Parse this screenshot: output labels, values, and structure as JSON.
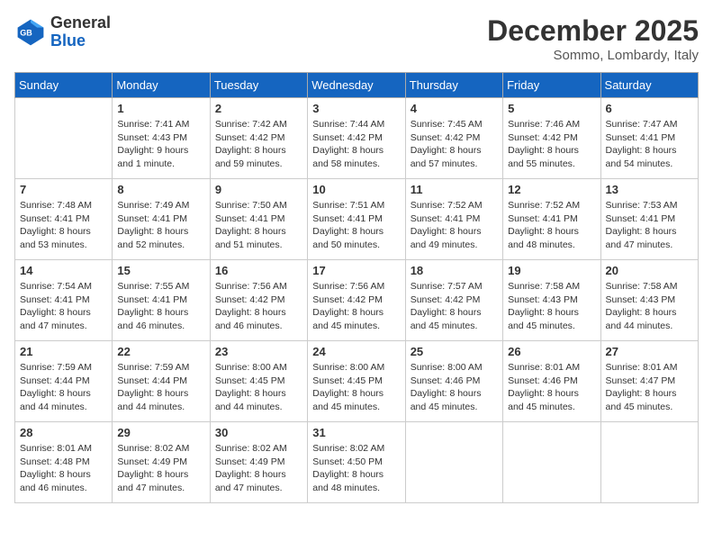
{
  "header": {
    "logo_general": "General",
    "logo_blue": "Blue",
    "month": "December 2025",
    "location": "Sommo, Lombardy, Italy"
  },
  "days_of_week": [
    "Sunday",
    "Monday",
    "Tuesday",
    "Wednesday",
    "Thursday",
    "Friday",
    "Saturday"
  ],
  "weeks": [
    [
      {
        "day": "",
        "content": ""
      },
      {
        "day": "1",
        "content": "Sunrise: 7:41 AM\nSunset: 4:43 PM\nDaylight: 9 hours\nand 1 minute."
      },
      {
        "day": "2",
        "content": "Sunrise: 7:42 AM\nSunset: 4:42 PM\nDaylight: 8 hours\nand 59 minutes."
      },
      {
        "day": "3",
        "content": "Sunrise: 7:44 AM\nSunset: 4:42 PM\nDaylight: 8 hours\nand 58 minutes."
      },
      {
        "day": "4",
        "content": "Sunrise: 7:45 AM\nSunset: 4:42 PM\nDaylight: 8 hours\nand 57 minutes."
      },
      {
        "day": "5",
        "content": "Sunrise: 7:46 AM\nSunset: 4:42 PM\nDaylight: 8 hours\nand 55 minutes."
      },
      {
        "day": "6",
        "content": "Sunrise: 7:47 AM\nSunset: 4:41 PM\nDaylight: 8 hours\nand 54 minutes."
      }
    ],
    [
      {
        "day": "7",
        "content": "Sunrise: 7:48 AM\nSunset: 4:41 PM\nDaylight: 8 hours\nand 53 minutes."
      },
      {
        "day": "8",
        "content": "Sunrise: 7:49 AM\nSunset: 4:41 PM\nDaylight: 8 hours\nand 52 minutes."
      },
      {
        "day": "9",
        "content": "Sunrise: 7:50 AM\nSunset: 4:41 PM\nDaylight: 8 hours\nand 51 minutes."
      },
      {
        "day": "10",
        "content": "Sunrise: 7:51 AM\nSunset: 4:41 PM\nDaylight: 8 hours\nand 50 minutes."
      },
      {
        "day": "11",
        "content": "Sunrise: 7:52 AM\nSunset: 4:41 PM\nDaylight: 8 hours\nand 49 minutes."
      },
      {
        "day": "12",
        "content": "Sunrise: 7:52 AM\nSunset: 4:41 PM\nDaylight: 8 hours\nand 48 minutes."
      },
      {
        "day": "13",
        "content": "Sunrise: 7:53 AM\nSunset: 4:41 PM\nDaylight: 8 hours\nand 47 minutes."
      }
    ],
    [
      {
        "day": "14",
        "content": "Sunrise: 7:54 AM\nSunset: 4:41 PM\nDaylight: 8 hours\nand 47 minutes."
      },
      {
        "day": "15",
        "content": "Sunrise: 7:55 AM\nSunset: 4:41 PM\nDaylight: 8 hours\nand 46 minutes."
      },
      {
        "day": "16",
        "content": "Sunrise: 7:56 AM\nSunset: 4:42 PM\nDaylight: 8 hours\nand 46 minutes."
      },
      {
        "day": "17",
        "content": "Sunrise: 7:56 AM\nSunset: 4:42 PM\nDaylight: 8 hours\nand 45 minutes."
      },
      {
        "day": "18",
        "content": "Sunrise: 7:57 AM\nSunset: 4:42 PM\nDaylight: 8 hours\nand 45 minutes."
      },
      {
        "day": "19",
        "content": "Sunrise: 7:58 AM\nSunset: 4:43 PM\nDaylight: 8 hours\nand 45 minutes."
      },
      {
        "day": "20",
        "content": "Sunrise: 7:58 AM\nSunset: 4:43 PM\nDaylight: 8 hours\nand 44 minutes."
      }
    ],
    [
      {
        "day": "21",
        "content": "Sunrise: 7:59 AM\nSunset: 4:44 PM\nDaylight: 8 hours\nand 44 minutes."
      },
      {
        "day": "22",
        "content": "Sunrise: 7:59 AM\nSunset: 4:44 PM\nDaylight: 8 hours\nand 44 minutes."
      },
      {
        "day": "23",
        "content": "Sunrise: 8:00 AM\nSunset: 4:45 PM\nDaylight: 8 hours\nand 44 minutes."
      },
      {
        "day": "24",
        "content": "Sunrise: 8:00 AM\nSunset: 4:45 PM\nDaylight: 8 hours\nand 45 minutes."
      },
      {
        "day": "25",
        "content": "Sunrise: 8:00 AM\nSunset: 4:46 PM\nDaylight: 8 hours\nand 45 minutes."
      },
      {
        "day": "26",
        "content": "Sunrise: 8:01 AM\nSunset: 4:46 PM\nDaylight: 8 hours\nand 45 minutes."
      },
      {
        "day": "27",
        "content": "Sunrise: 8:01 AM\nSunset: 4:47 PM\nDaylight: 8 hours\nand 45 minutes."
      }
    ],
    [
      {
        "day": "28",
        "content": "Sunrise: 8:01 AM\nSunset: 4:48 PM\nDaylight: 8 hours\nand 46 minutes."
      },
      {
        "day": "29",
        "content": "Sunrise: 8:02 AM\nSunset: 4:49 PM\nDaylight: 8 hours\nand 47 minutes."
      },
      {
        "day": "30",
        "content": "Sunrise: 8:02 AM\nSunset: 4:49 PM\nDaylight: 8 hours\nand 47 minutes."
      },
      {
        "day": "31",
        "content": "Sunrise: 8:02 AM\nSunset: 4:50 PM\nDaylight: 8 hours\nand 48 minutes."
      },
      {
        "day": "",
        "content": ""
      },
      {
        "day": "",
        "content": ""
      },
      {
        "day": "",
        "content": ""
      }
    ]
  ]
}
